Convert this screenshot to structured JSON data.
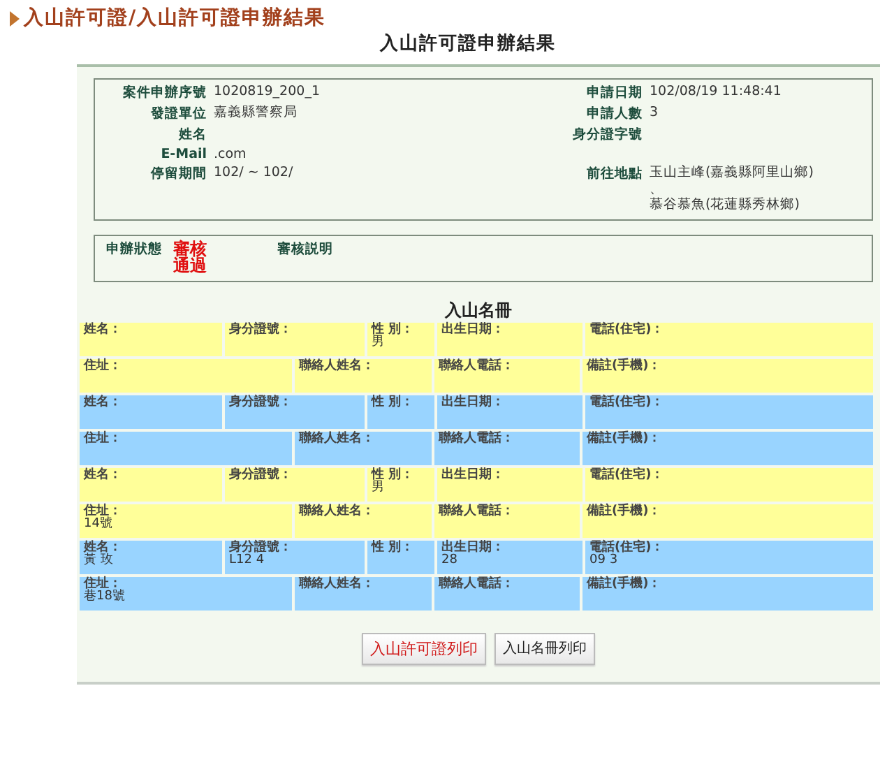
{
  "breadcrumb": "入山許可證/入山許可證申辦結果",
  "page_title": "入山許可證申辦結果",
  "application": {
    "rows": [
      [
        {
          "label": "案件申辦序號",
          "lines": [
            "1020819_200_1"
          ]
        },
        {
          "label": "申請日期",
          "lines": [
            "102/08/19 11:48:41"
          ]
        }
      ],
      [
        {
          "label": "發證單位",
          "lines": [
            "嘉義縣警察局"
          ]
        },
        {
          "label": "申請人數",
          "lines": [
            "3"
          ]
        }
      ],
      [
        {
          "label": "姓名"
        },
        {
          "label": "身分證字號"
        }
      ],
      [
        {
          "label": "E-Mail",
          "lines": [
            ".com"
          ]
        }
      ],
      [
        {
          "label": "停留期間",
          "lines": [
            "102/ ~ 102/"
          ]
        },
        {
          "label": "前往地點",
          "lines": [
            "玉山主峰(嘉義縣阿里山鄉)",
            "、",
            "慕谷慕魚(花蓮縣秀林鄉)"
          ]
        }
      ]
    ]
  },
  "status": {
    "label": "申辦狀態",
    "value": "審核通過",
    "note_label": "審核説明"
  },
  "roster": {
    "title": "入山名冊",
    "people": [
      {
        "color": "#ffff99",
        "row1": [
          {
            "label": "姓名："
          },
          {
            "label": "身分證號："
          },
          {
            "label": "性 別：",
            "value": "男"
          },
          {
            "label": "出生日期："
          },
          {
            "label": "電話(住宅)："
          }
        ],
        "row2": [
          {
            "label": "住址："
          },
          {
            "label": "聯絡人姓名："
          },
          {
            "label": "聯絡人電話："
          },
          {
            "label": "備註(手機)："
          }
        ]
      },
      {
        "color": "#99d4ff",
        "row1": [
          {
            "label": "姓名："
          },
          {
            "label": "身分證號："
          },
          {
            "label": "性 別："
          },
          {
            "label": "出生日期："
          },
          {
            "label": "電話(住宅)："
          }
        ],
        "row2": [
          {
            "label": "住址："
          },
          {
            "label": "聯絡人姓名："
          },
          {
            "label": "聯絡人電話："
          },
          {
            "label": "備註(手機)："
          }
        ]
      },
      {
        "color": "#ffff99",
        "row1": [
          {
            "label": "姓名："
          },
          {
            "label": "身分證號："
          },
          {
            "label": "性 別：",
            "value": "男"
          },
          {
            "label": "出生日期："
          },
          {
            "label": "電話(住宅)："
          }
        ],
        "row2": [
          {
            "label": "住址：",
            "value": "14號"
          },
          {
            "label": "聯絡人姓名："
          },
          {
            "label": "聯絡人電話："
          },
          {
            "label": "備註(手機)："
          }
        ]
      },
      {
        "color": "#99d4ff",
        "row1": [
          {
            "label": "姓名：",
            "value": "黃 玫"
          },
          {
            "label": "身分證號：",
            "value": "L12 4"
          },
          {
            "label": "性 別："
          },
          {
            "label": "出生日期：",
            "value": "28"
          },
          {
            "label": "電話(住宅)：",
            "value": "09 3"
          }
        ],
        "row2": [
          {
            "label": "住址：",
            "value": "巷18號"
          },
          {
            "label": "聯絡人姓名："
          },
          {
            "label": "聯絡人電話："
          },
          {
            "label": "備註(手機)："
          }
        ]
      }
    ]
  },
  "buttons": [
    {
      "label": "入山許可證列印",
      "kind": "primary"
    },
    {
      "label": "入山名冊列印",
      "kind": "secondary"
    }
  ]
}
